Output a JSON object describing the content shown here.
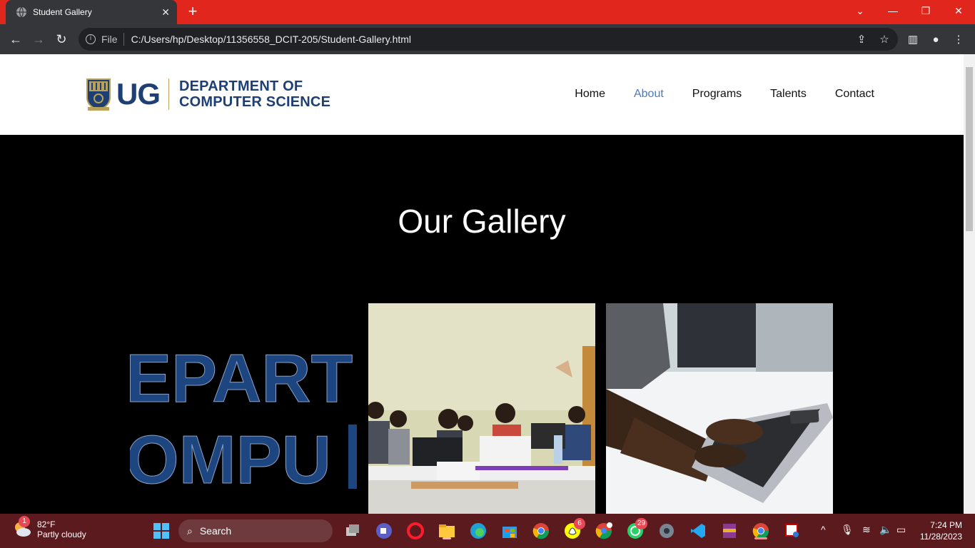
{
  "browser": {
    "tab_title": "Student Gallery",
    "new_tab": "+",
    "url_scheme_label": "File",
    "url": "C:/Users/hp/Desktop/11356558_DCIT-205/Student-Gallery.html"
  },
  "header": {
    "logo_ug": "UG",
    "logo_line1": "DEPARTMENT OF",
    "logo_line2": "COMPUTER SCIENCE",
    "nav": [
      "Home",
      "About",
      "Programs",
      "Talents",
      "Contact"
    ],
    "active_nav": "About"
  },
  "main": {
    "gallery_title": "Our Gallery",
    "photo1_text_line1": "EPART",
    "photo1_text_line2": "OMPU"
  },
  "taskbar": {
    "weather_temp": "82°F",
    "weather_desc": "Partly cloudy",
    "weather_badge": "1",
    "search_label": "Search",
    "snapchat_badge": "6",
    "whatsapp_badge": "29",
    "time": "7:24 PM",
    "date": "11/28/2023"
  },
  "colors": {
    "tabstrip": "#e0261d",
    "brand_blue": "#1d3f74",
    "active_nav": "#4e7ab5",
    "taskbar": "#5a1a1e"
  }
}
